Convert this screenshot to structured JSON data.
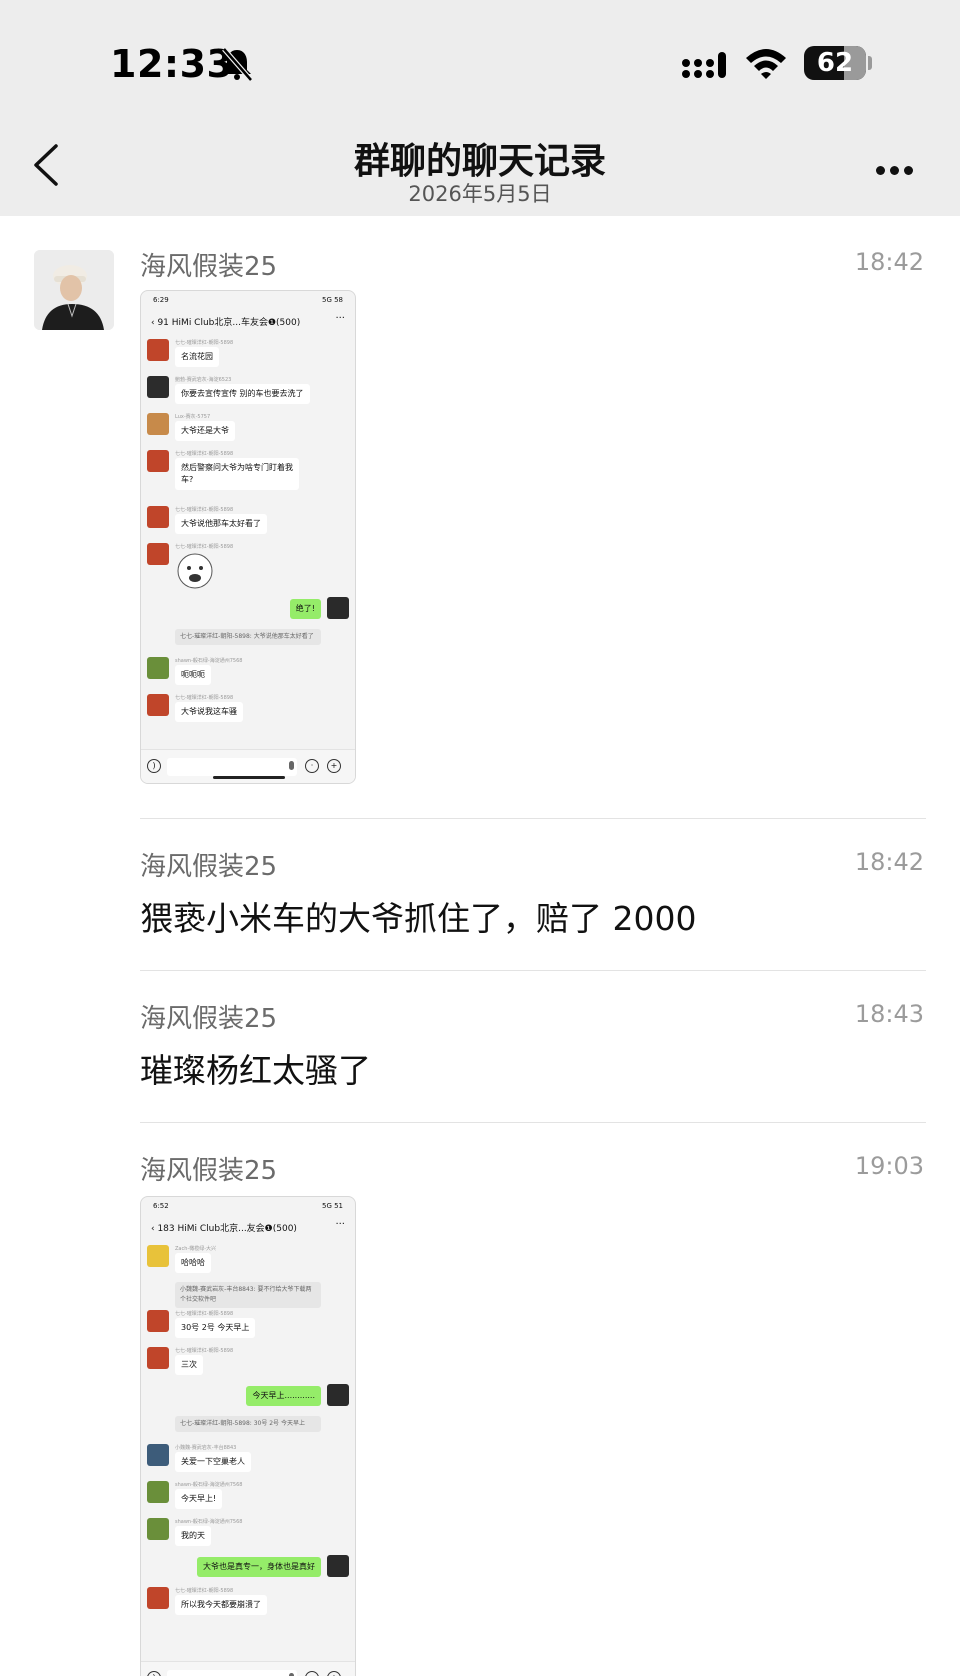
{
  "status_bar": {
    "time": "12:33",
    "battery": "62"
  },
  "nav": {
    "title": "群聊的聊天记录",
    "subtitle": "2026年5月5日"
  },
  "messages": [
    {
      "sender": "海风假装25",
      "time": "18:42",
      "type": "image",
      "image": {
        "status_time": "6:29",
        "status_right": "5G 58",
        "header": "HiMi Club北京...车友会❶(500)",
        "back_count": "91",
        "rows": [
          {
            "name": "七七-璀璨洋红-朝阳-5898",
            "text": "名流花园",
            "avatar": "#c0452a"
          },
          {
            "name": "鲍勃-赛武岩灰-海淀6523",
            "text": "你要去宣传宣传 别的车也要去洗了",
            "avatar": "#2c2c2c"
          },
          {
            "name": "Lux-赛灰-5757",
            "text": "大爷还是大爷",
            "avatar": "#c78a4a"
          },
          {
            "name": "七七-璀璨洋红-朝阳-5898",
            "text": "然后警察问大爷为啥专门盯着我",
            "text2": "车?",
            "avatar": "#c0452a"
          },
          {
            "name": "七七-璀璨洋红-朝阳-5898",
            "text": "大爷说他那车太好看了",
            "avatar": "#c0452a"
          },
          {
            "name": "七七-璀璨洋红-朝阳-5898",
            "sticker": true,
            "avatar": "#c0452a"
          },
          {
            "self": true,
            "text": "绝了!"
          },
          {
            "quote": "七七-璀璨洋红-朝阳-5898: 大爷说他那车太好看了"
          },
          {
            "name": "shawn-毅石绿-海淀通州7568",
            "text": "呃呃呃",
            "avatar": "#6a8f3a"
          },
          {
            "name": "七七-璀璨洋红-朝阳-5898",
            "text": "大爷说我这车骚",
            "avatar": "#c0452a"
          }
        ]
      }
    },
    {
      "sender": "海风假装25",
      "time": "18:42",
      "type": "text",
      "text": "猥亵小米车的大爷抓住了，赔了 2000"
    },
    {
      "sender": "海风假装25",
      "time": "18:43",
      "type": "text",
      "text": "璀璨杨红太骚了"
    },
    {
      "sender": "海风假装25",
      "time": "19:03",
      "type": "image",
      "image": {
        "status_time": "6:52",
        "status_right": "5G 51",
        "header": "HiMi Club北京...友会❶(500)",
        "back_count": "183",
        "rows": [
          {
            "name": "Zach-橄榄绿-大兴",
            "text": "哈哈哈",
            "avatar": "#e8c23a"
          },
          {
            "quote": "小魏魏-赛武岩灰-丰台8843: 要不行给大爷下载两个社交软件吧"
          },
          {
            "name": "七七-璀璨洋红-朝阳-5898",
            "text": "30号 2号 今天早上",
            "avatar": "#c0452a"
          },
          {
            "name": "七七-璀璨洋红-朝阳-5898",
            "text": "三次",
            "avatar": "#c0452a"
          },
          {
            "self": true,
            "text": "今天早上............"
          },
          {
            "quote": "七七-璀璨洋红-朝阳-5898: 30号 2号 今天早上"
          },
          {
            "name": "小魏魏-赛武岩灰-丰台8843",
            "text": "关爱一下空巢老人",
            "avatar": "#3d5c7a"
          },
          {
            "name": "shawn-毅石绿-海淀通州7568",
            "text": "今天早上!",
            "avatar": "#6a8f3a"
          },
          {
            "name": "shawn-毅石绿-海淀通州7568",
            "text": "我的天",
            "avatar": "#6a8f3a"
          },
          {
            "self": true,
            "text": "大爷也是真专一，身体也是真好"
          },
          {
            "name": "七七-璀璨洋红-朝阳-5898",
            "text": "所以我今天都要崩溃了",
            "avatar": "#c0452a"
          }
        ]
      }
    }
  ],
  "colors": {
    "header_bg": "#ededed",
    "bubble_green": "#95ec69"
  }
}
